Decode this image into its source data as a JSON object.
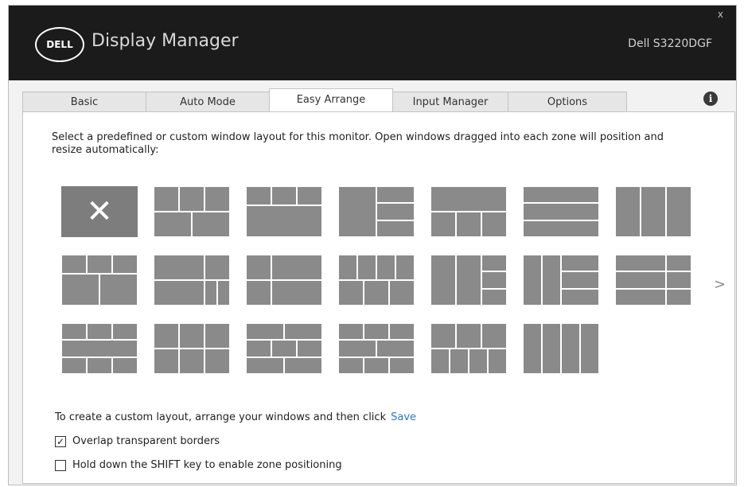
{
  "titlebar": {
    "logo_text": "DELL",
    "app_title": "Display Manager",
    "monitor_name": "Dell S3220DGF",
    "close_glyph": "x"
  },
  "tabs": [
    {
      "label": "Basic",
      "active": false
    },
    {
      "label": "Auto Mode",
      "active": false
    },
    {
      "label": "Easy Arrange",
      "active": true
    },
    {
      "label": "Input Manager",
      "active": false
    },
    {
      "label": "Options",
      "active": false
    }
  ],
  "info_icon": {
    "glyph": "i"
  },
  "description": "Select a predefined or custom window layout for this monitor.  Open windows dragged into each zone will position and resize automatically:",
  "layouts": {
    "none_glyph": "✕",
    "next_glyph": ">"
  },
  "custom": {
    "text": "To create a custom layout, arrange your windows and then click",
    "save_label": "Save"
  },
  "options": {
    "overlap": {
      "label": "Overlap transparent borders",
      "checked": true,
      "mark": "✓"
    },
    "shift": {
      "label": "Hold down the SHIFT key to enable zone positioning",
      "checked": false,
      "mark": ""
    }
  },
  "colors": {
    "titlebar_bg": "#1b1b1b",
    "zone_gray": "#8a8a8a",
    "link_blue": "#2e75c7"
  }
}
